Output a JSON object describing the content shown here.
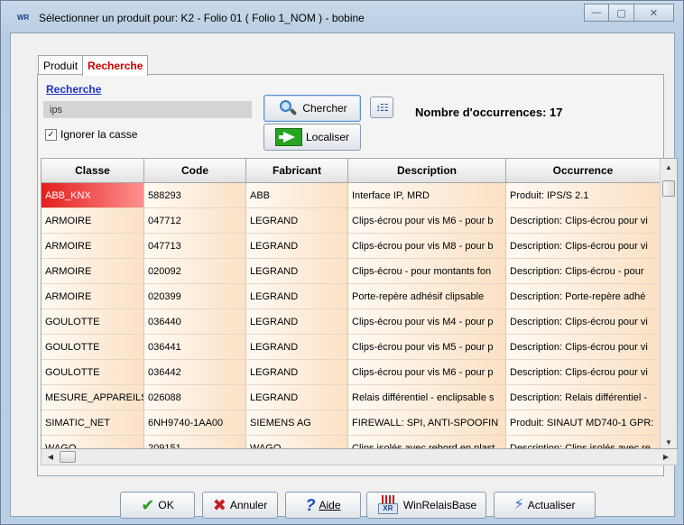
{
  "window": {
    "title": "Sélectionner un produit pour: K2 - Folio 01 ( Folio 1_NOM ) - bobine",
    "app_icon_text": "WR",
    "controls": {
      "minimize": "—",
      "maximize": "▢",
      "close": "✕"
    }
  },
  "tabs": [
    {
      "label": "Produit",
      "active": false
    },
    {
      "label": "Recherche",
      "active": true
    }
  ],
  "search": {
    "section_title": "Recherche",
    "input_value": "ips",
    "ignore_case_label": "Ignorer la casse",
    "ignore_case_checked": true,
    "search_button": "Chercher",
    "locate_button": "Localiser",
    "sort_icon": "sort-icon",
    "occurrences_text": "Nombre d'occurrences: 17"
  },
  "grid": {
    "columns": [
      "Classe",
      "Code",
      "Fabricant",
      "Description",
      "Occurrence"
    ],
    "rows": [
      [
        "ABB_KNX",
        "588293",
        "ABB",
        "Interface IP, MRD",
        "Produit: IPS/S 2.1"
      ],
      [
        "ARMOIRE",
        "047712",
        "LEGRAND",
        "Clips-écrou pour vis M6 - pour b",
        "Description: Clips-écrou pour vi"
      ],
      [
        "ARMOIRE",
        "047713",
        "LEGRAND",
        "Clips-écrou pour vis M8 - pour b",
        "Description: Clips-écrou pour vi"
      ],
      [
        "ARMOIRE",
        "020092",
        "LEGRAND",
        "Clips-écrou - pour montants fon",
        "Description: Clips-écrou - pour"
      ],
      [
        "ARMOIRE",
        "020399",
        "LEGRAND",
        "Porte-repère adhésif clipsable",
        "Description: Porte-repère adhé"
      ],
      [
        "GOULOTTE",
        "036440",
        "LEGRAND",
        "Clips-écrou pour vis M4 - pour p",
        "Description: Clips-écrou pour vi"
      ],
      [
        "GOULOTTE",
        "036441",
        "LEGRAND",
        "Clips-écrou pour vis M5 - pour p",
        "Description: Clips-écrou pour vi"
      ],
      [
        "GOULOTTE",
        "036442",
        "LEGRAND",
        "Clips-écrou pour vis M6 - pour p",
        "Description: Clips-écrou pour vi"
      ],
      [
        "MESURE_APPAREILS",
        "026088",
        "LEGRAND",
        "Relais différentiel - enclipsable s",
        "Description: Relais différentiel -"
      ],
      [
        "SIMATIC_NET",
        "6NH9740-1AA00",
        "SIEMENS AG",
        "FIREWALL: SPI, ANTI-SPOOFIN",
        "Produit: SINAUT MD740-1 GPR:"
      ],
      [
        "WAGO",
        "209151",
        "WAGO",
        "Clips isolés avec rebord en plast",
        "Description: Clips isolés avec re"
      ]
    ],
    "selected_row": 0
  },
  "footer_buttons": {
    "ok": "OK",
    "cancel": "Annuler",
    "help": "Aide",
    "winrelaisbase": "WinRelaisBase",
    "update": "Actualiser"
  },
  "colors": {
    "selected_cell": "#e41d1d",
    "row_gradient_end": "#fbe1c5",
    "link_blue": "#1f33c9",
    "active_tab_red": "#cc0000"
  }
}
